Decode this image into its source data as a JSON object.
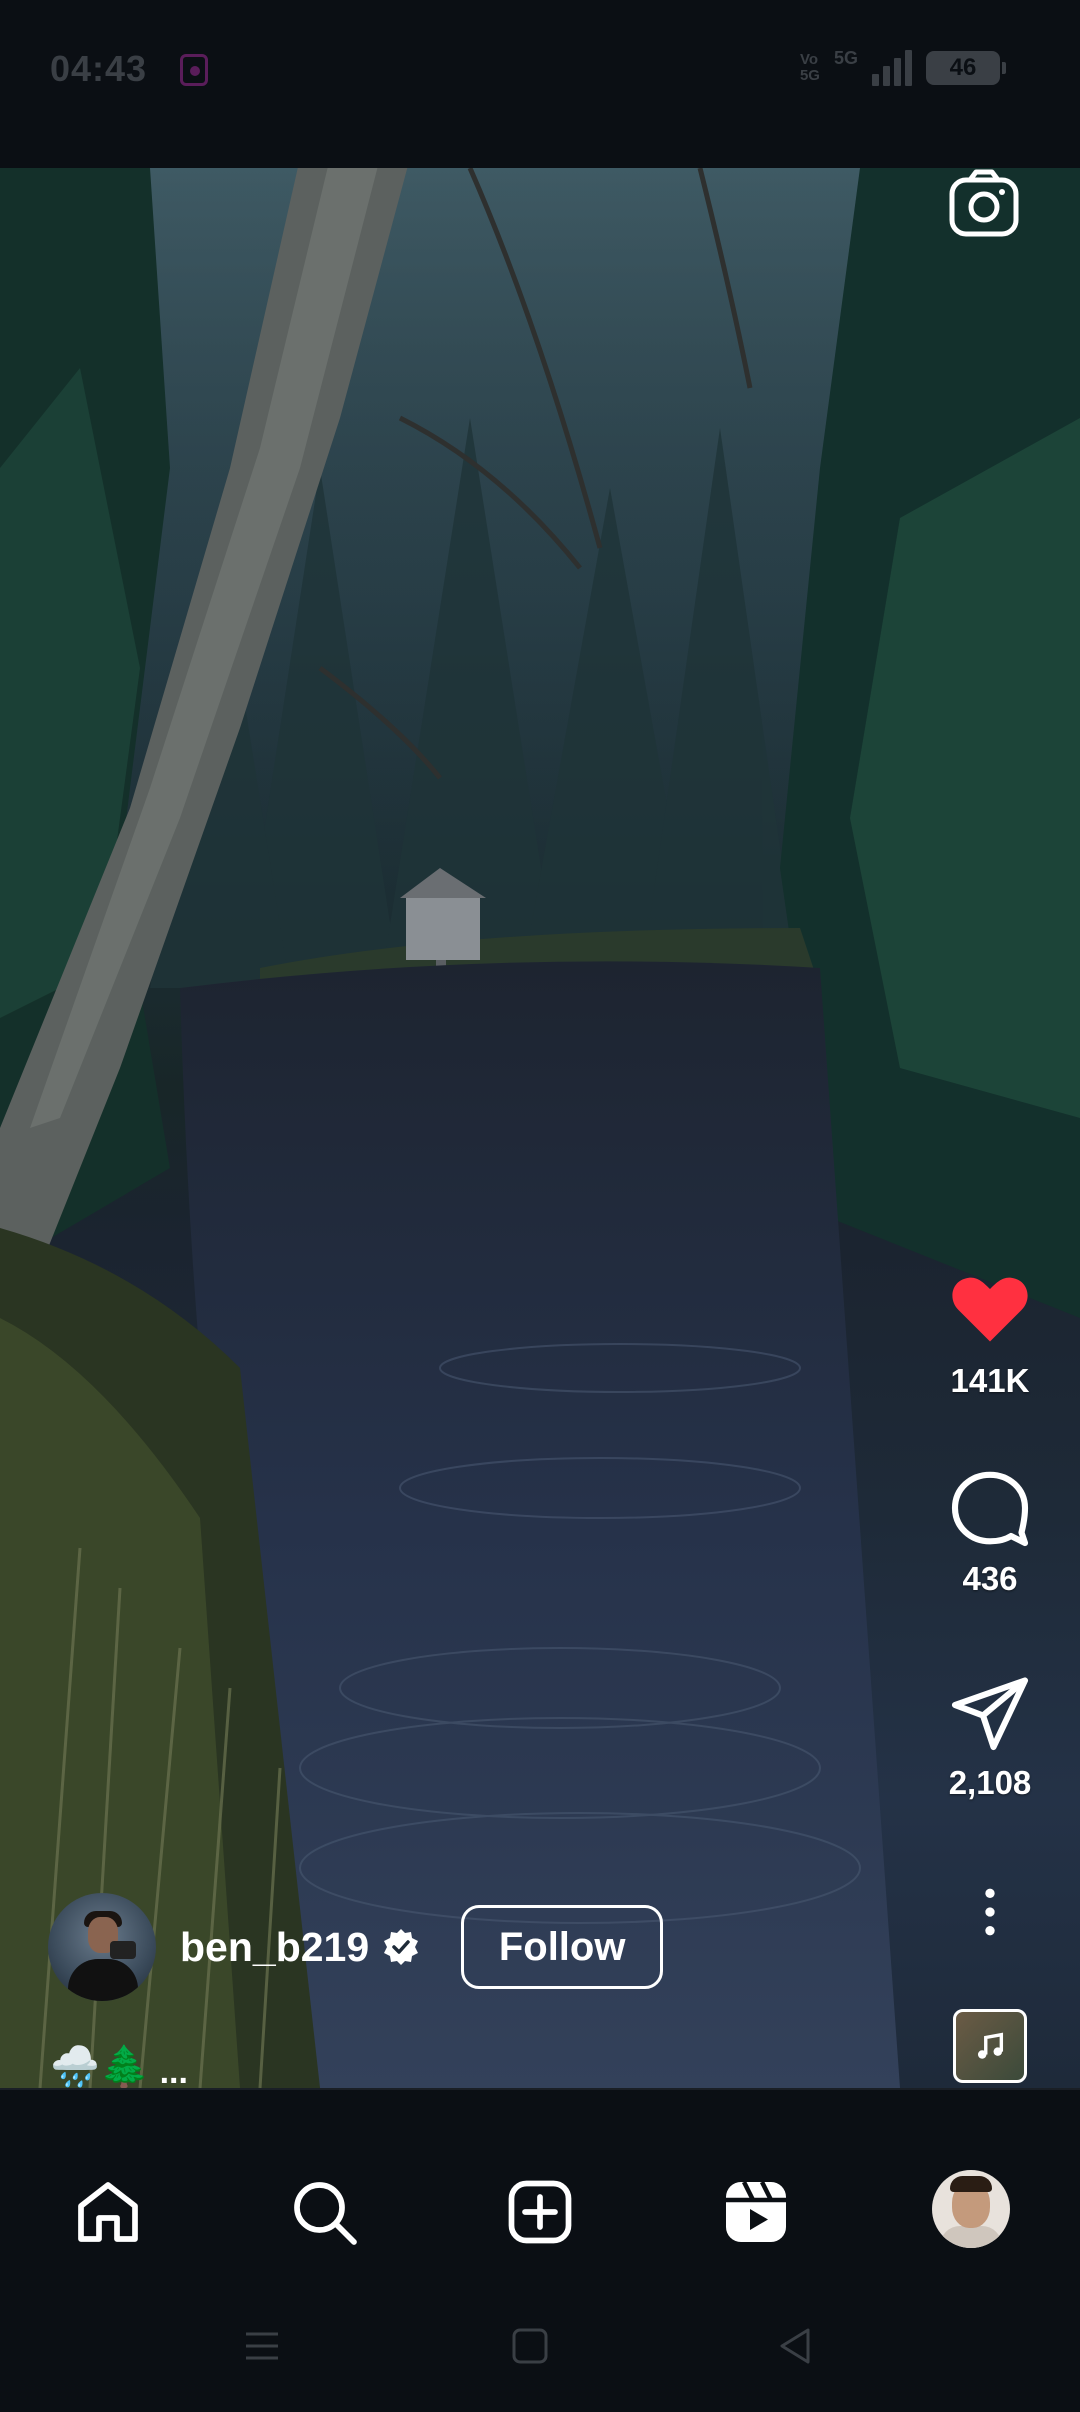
{
  "status_bar": {
    "time": "04:43",
    "network_volte": "Vo\n5G",
    "network_type": "5G",
    "battery_level": "46"
  },
  "post": {
    "author": {
      "username": "ben_b219",
      "verified": true
    },
    "follow_label": "Follow",
    "caption": "🌧️🌲",
    "caption_more": "...",
    "actions": {
      "likes": "141K",
      "comments": "436",
      "shares": "2,108"
    },
    "liked": true,
    "colors": {
      "like_active": "#ff3040",
      "text": "#ffffff"
    }
  },
  "bottom_nav": {
    "items": [
      "home-icon",
      "search-icon",
      "create-icon",
      "reels-icon",
      "profile-avatar"
    ]
  },
  "system_nav": {
    "items": [
      "menu-icon",
      "home-square-icon",
      "back-icon"
    ]
  }
}
